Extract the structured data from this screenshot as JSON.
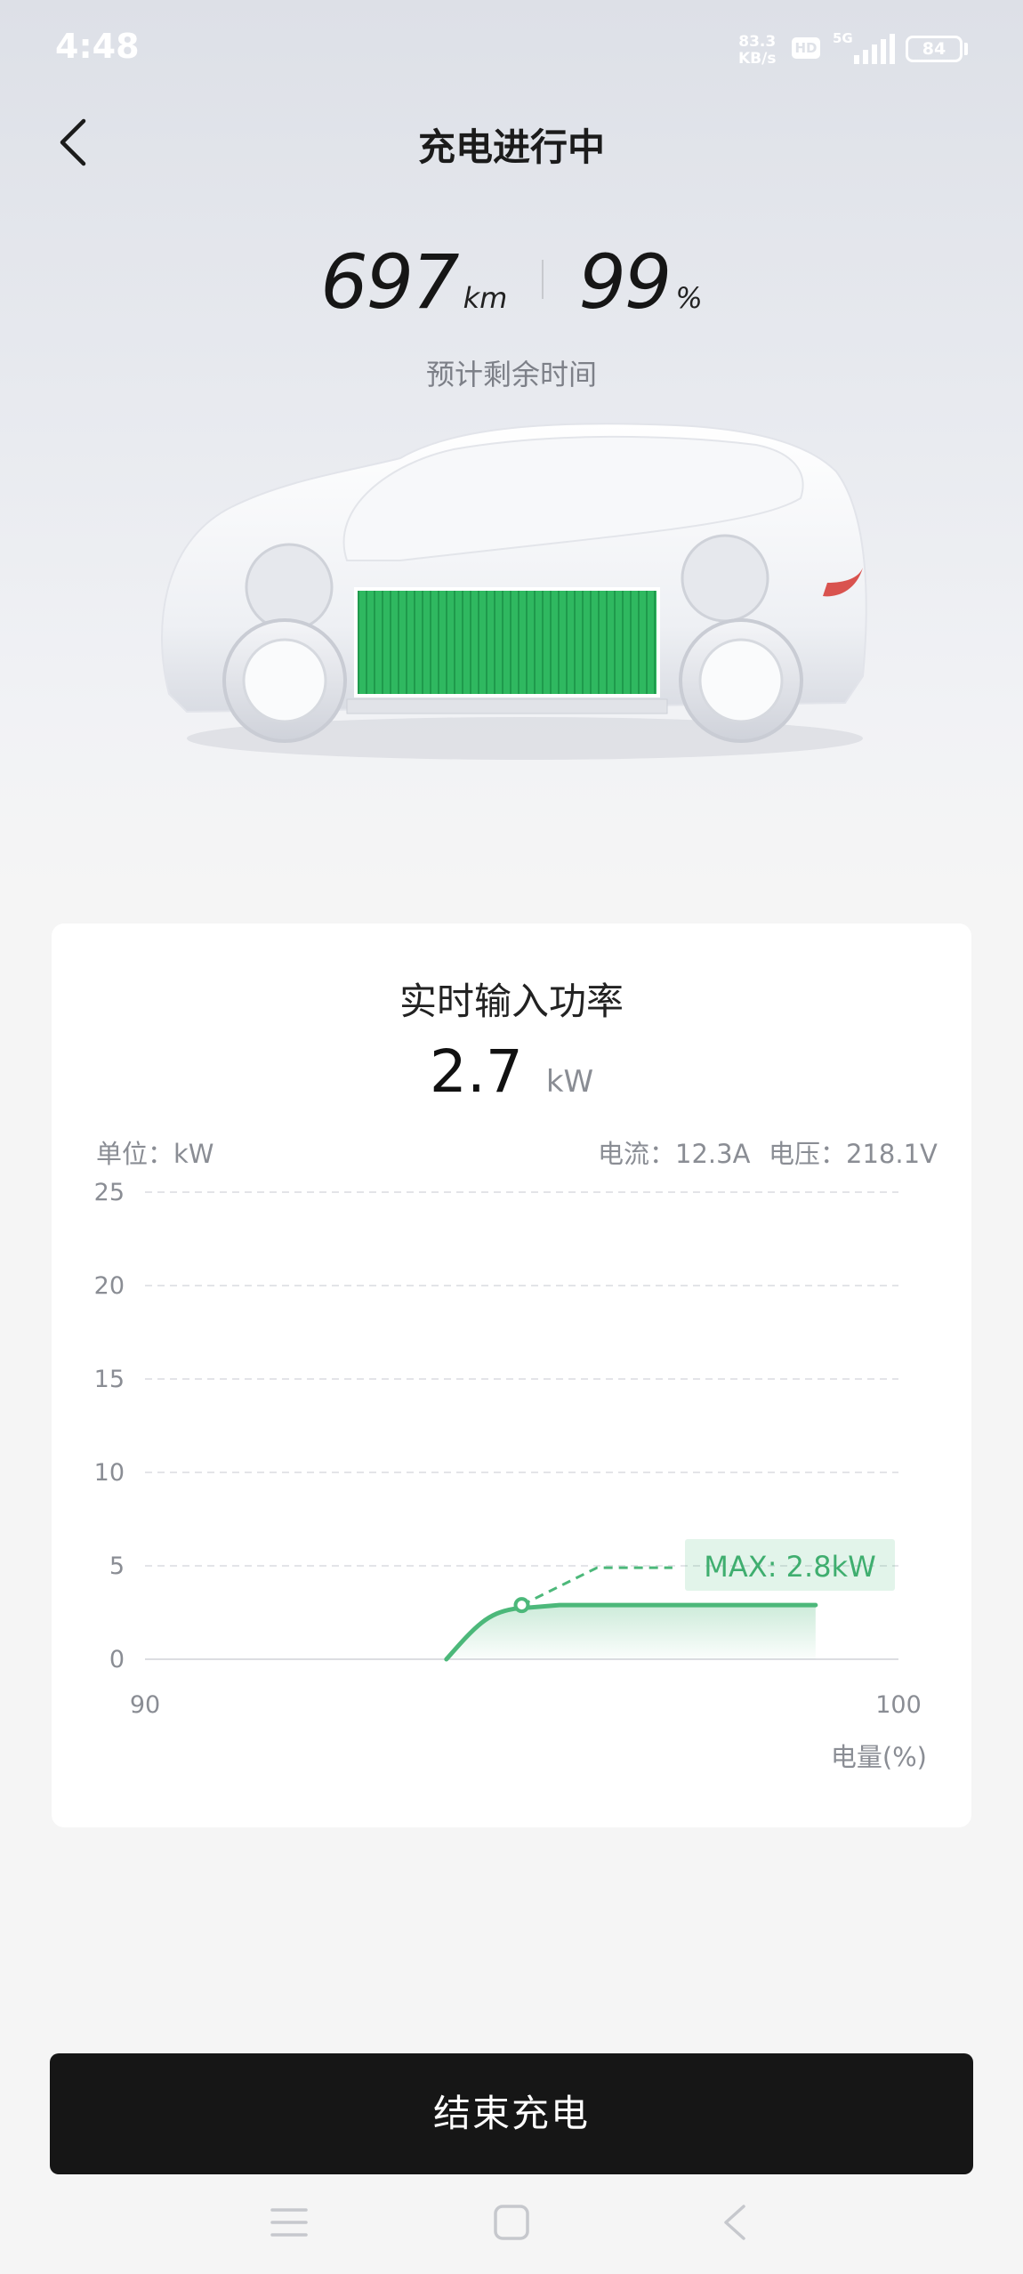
{
  "status_bar": {
    "time": "4:48",
    "net_speed_value": "83.3",
    "net_speed_unit": "KB/s",
    "hd": "HD",
    "network": "5G",
    "battery": "84"
  },
  "header": {
    "title": "充电进行中"
  },
  "stats": {
    "range_value": "697",
    "range_unit": "km",
    "soc_value": "99",
    "soc_unit": "%",
    "remaining_label": "预计剩余时间"
  },
  "card": {
    "title": "实时输入功率",
    "power_value": "2.7",
    "power_unit": "kW",
    "unit_label": "单位：kW",
    "current_label": "电流：12.3A",
    "voltage_label": "电压：218.1V"
  },
  "chart_data": {
    "type": "line",
    "title": "实时输入功率",
    "ylabel": "单位：kW",
    "xlabel": "电量(%)",
    "xlim": [
      90,
      100
    ],
    "ylim": [
      0,
      25
    ],
    "x_ticks": [
      "90",
      "100"
    ],
    "y_ticks": [
      "25",
      "20",
      "15",
      "10",
      "5",
      "0"
    ],
    "grid": true,
    "series": [
      {
        "style": "solid",
        "color": "#4cb87a",
        "points": [
          [
            94.0,
            0
          ],
          [
            94.4,
            1.6
          ],
          [
            94.9,
            2.7
          ],
          [
            95.5,
            2.9
          ],
          [
            97.0,
            2.9
          ],
          [
            98.9,
            2.9
          ]
        ]
      },
      {
        "style": "dashed",
        "color": "#4cb87a",
        "points": [
          [
            95.0,
            2.9
          ],
          [
            96.0,
            4.9
          ],
          [
            97.0,
            4.9
          ]
        ]
      }
    ],
    "marker": {
      "x": 95.0,
      "y": 2.9
    },
    "annotation": "MAX: 2.8kW"
  },
  "actions": {
    "end_label": "结束充电"
  },
  "colors": {
    "accent_green": "#4cb87a",
    "button_bg": "#161616",
    "battery_green": "#2fb860"
  }
}
